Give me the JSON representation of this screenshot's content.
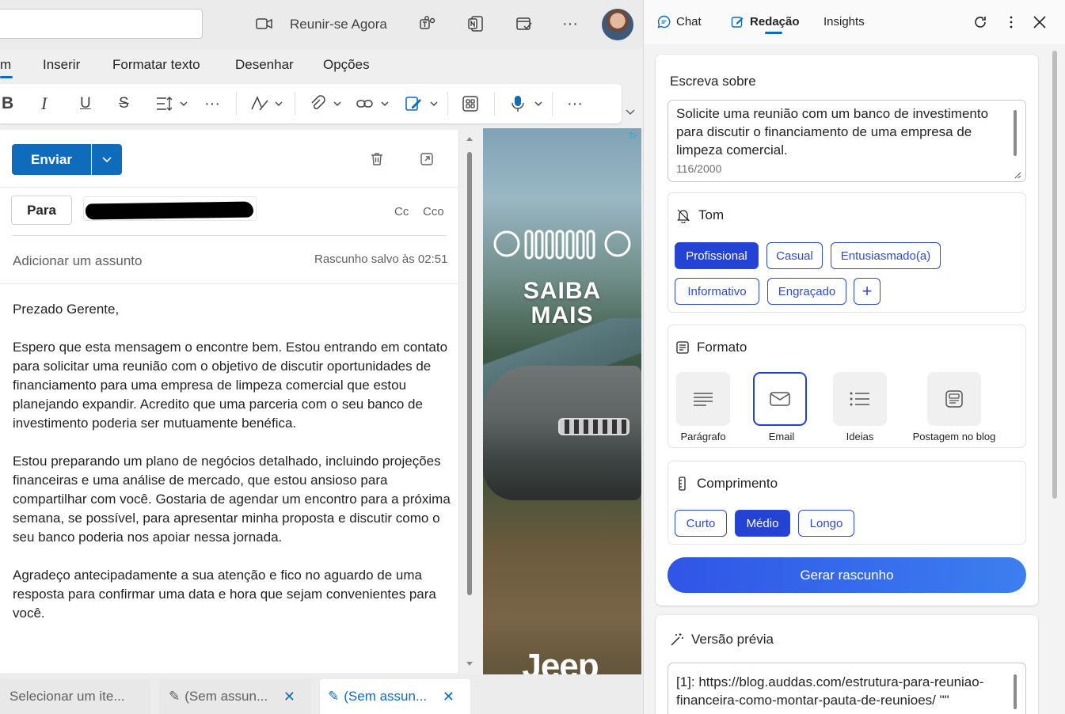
{
  "outlook": {
    "meet_now": "Reunir-se Agora",
    "ribbon_tabs": [
      "m",
      "Inserir",
      "Formatar texto",
      "Desenhar",
      "Opções"
    ],
    "send_label": "Enviar",
    "to_label": "Para",
    "cc_label": "Cc",
    "bcc_label": "Cco",
    "subject_placeholder": "Adicionar um assunto",
    "draft_saved": "Rascunho salvo às 02:51",
    "body": [
      "Prezado Gerente,",
      "Espero que esta mensagem o encontre bem. Estou entrando em contato para solicitar uma reunião com o objetivo de discutir oportunidades de financiamento para uma empresa de limpeza comercial que estou planejando expandir. Acredito que uma parceria com o seu banco de investimento poderia ser mutuamente benéfica.",
      "Estou preparando um plano de negócios detalhado, incluindo projeções financeiras e uma análise de mercado, que estou ansioso para compartilhar com você. Gostaria de agendar um encontro para a próxima semana, se possível, para apresentar minha proposta e discutir como o seu banco poderia nos apoiar nessa jornada.",
      "Agradeço antecipadamente a sua atenção e fico no aguardo de uma resposta para confirmar uma data e hora que sejam convenientes para você."
    ],
    "bottom_tabs": [
      "Selecionar um ite...",
      "(Sem assun...",
      "(Sem assun..."
    ]
  },
  "ad": {
    "title_line1": "SAIBA",
    "title_line2": "MAIS",
    "brand": "Jeep",
    "badge": "▷"
  },
  "copilot": {
    "tabs": [
      "Chat",
      "Redação",
      "Insights"
    ],
    "active_tab": "Redação",
    "write_about_label": "Escreva sobre",
    "prompt": "Solicite uma reunião com um banco de investimento para discutir o financiamento de uma empresa de limpeza comercial.",
    "char_count": "116/2000",
    "tone_label": "Tom",
    "tones": [
      "Profissional",
      "Casual",
      "Entusiasmado(a)",
      "Informativo",
      "Engraçado"
    ],
    "selected_tone": "Profissional",
    "add_tone": "+",
    "format_label": "Formato",
    "formats": [
      "Parágrafo",
      "Email",
      "Ideias",
      "Postagem no blog"
    ],
    "selected_format": "Email",
    "length_label": "Comprimento",
    "lengths": [
      "Curto",
      "Médio",
      "Longo"
    ],
    "selected_length": "Médio",
    "generate_label": "Gerar rascunho",
    "preview_label": "Versão prévia",
    "preview_text": "[1]: https://blog.auddas.com/estrutura-para-reuniao-financeira-como-montar-pauta-de-reunioes/ \"\"",
    "accent_color": "#2442d4"
  }
}
